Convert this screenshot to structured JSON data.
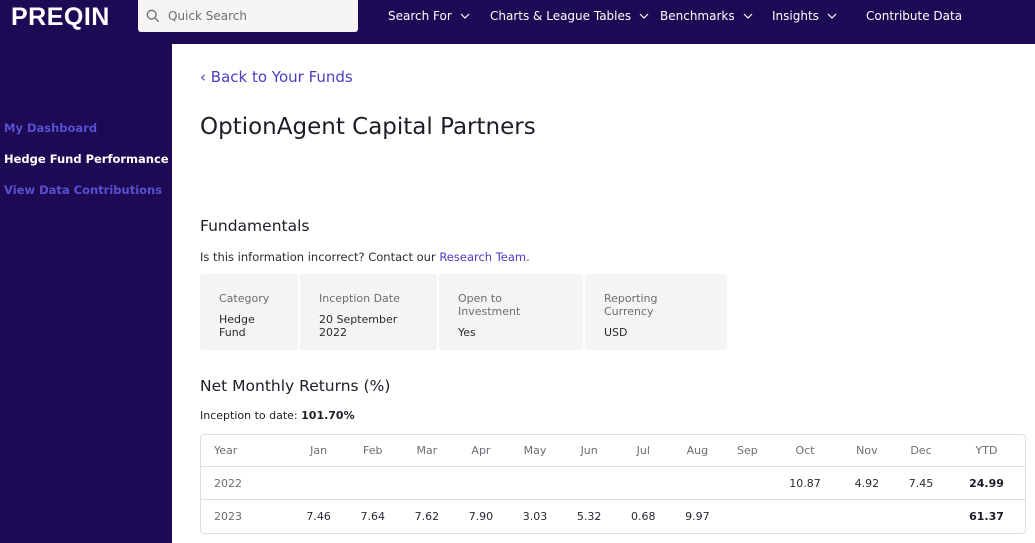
{
  "header": {
    "logo": "PREQIN",
    "search_placeholder": "Quick Search",
    "nav": [
      {
        "label": "Search For",
        "has_dropdown": true
      },
      {
        "label": "Charts & League Tables",
        "has_dropdown": true
      },
      {
        "label": "Benchmarks",
        "has_dropdown": true
      },
      {
        "label": "Insights",
        "has_dropdown": true
      },
      {
        "label": "Contribute Data",
        "has_dropdown": false
      }
    ]
  },
  "sidebar": {
    "items": [
      {
        "label": "My Dashboard",
        "active": false
      },
      {
        "label": "Hedge Fund Performance",
        "active": true
      },
      {
        "label": "View Data Contributions",
        "active": false
      }
    ]
  },
  "main": {
    "back_link": "Back to Your Funds",
    "fund_name": "OptionAgent Capital Partners",
    "fundamentals": {
      "heading": "Fundamentals",
      "note_text": "Is this information incorrect? Contact our ",
      "note_link": "Research Team.",
      "fields": [
        {
          "label": "Category",
          "value": "Hedge Fund"
        },
        {
          "label": "Inception Date",
          "value": "20 September 2022"
        },
        {
          "label": "Open to Investment",
          "value": "Yes"
        },
        {
          "label": "Reporting Currency",
          "value": "USD"
        }
      ]
    },
    "returns": {
      "heading": "Net Monthly Returns (%)",
      "itd_label": "Inception to date: ",
      "itd_value": "101.70%",
      "columns": [
        "Year",
        "Jan",
        "Feb",
        "Mar",
        "Apr",
        "May",
        "Jun",
        "Jul",
        "Aug",
        "Sep",
        "Oct",
        "Nov",
        "Dec",
        "YTD"
      ],
      "rows": [
        {
          "year": "2022",
          "values": [
            "",
            "",
            "",
            "",
            "",
            "",
            "",
            "",
            "10.87",
            "4.92",
            "7.45"
          ],
          "ytd": "24.99"
        },
        {
          "year": "2023",
          "values": [
            "7.46",
            "7.64",
            "7.62",
            "7.90",
            "3.03",
            "5.32",
            "0.68",
            "9.97",
            "",
            "",
            "",
            ""
          ],
          "ytd": "61.37"
        }
      ]
    }
  },
  "colors": {
    "brand_navy": "#1c0a55",
    "link_purple": "#4a3ec2",
    "sidebar_muted": "#5a4fd0",
    "card_bg": "#f5f4f3"
  }
}
